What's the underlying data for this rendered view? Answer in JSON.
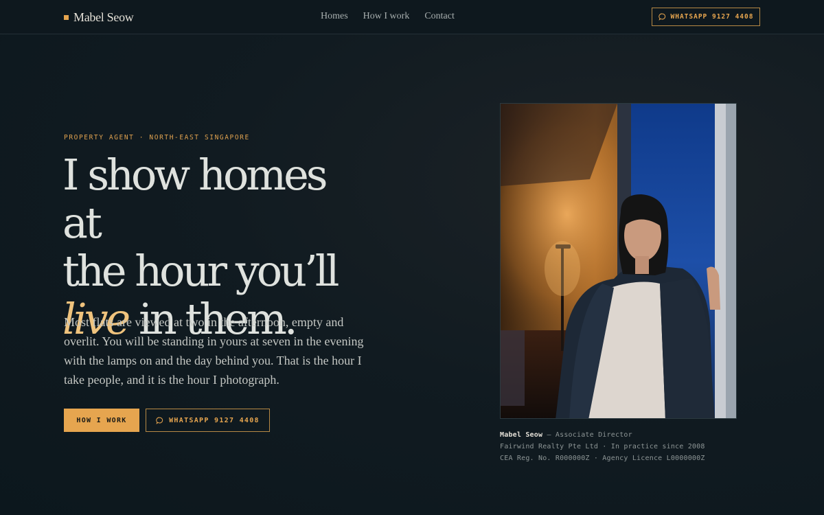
{
  "nav": {
    "brand": "Mabel Seow",
    "links": [
      "Homes",
      "How I work",
      "Contact"
    ],
    "cta_label": "WHATSAPP 9127 4408"
  },
  "hero": {
    "eyebrow": "PROPERTY AGENT · NORTH-EAST SINGAPORE",
    "headline_line1": "I show homes at",
    "headline_line2": "the hour you’ll",
    "headline_accent": "live",
    "headline_line3_rest": " in them.",
    "lede": "Most flats are viewed at two in the afternoon, empty and overlit. You will be standing in yours at seven in the evening with the lamps on and the day behind you. That is the hour I take people, and it is the hour I photograph.",
    "primary_cta": "HOW I WORK",
    "secondary_cta": "WHATSAPP 9127 4408"
  },
  "profile": {
    "name": "Mabel Seow",
    "role": " — Associate Director",
    "line2": "Fairwind Realty Pte Ltd · In practice since 2008",
    "line3": "CEA Reg. No. R000000Z · Agency Licence L0000000Z"
  },
  "icons": {
    "brand": "square-mark-icon",
    "chat": "chat-bubble-icon"
  },
  "colors": {
    "accent": "#e6a54f",
    "accent_soft": "#efc37d",
    "background": "#0f1a20"
  }
}
